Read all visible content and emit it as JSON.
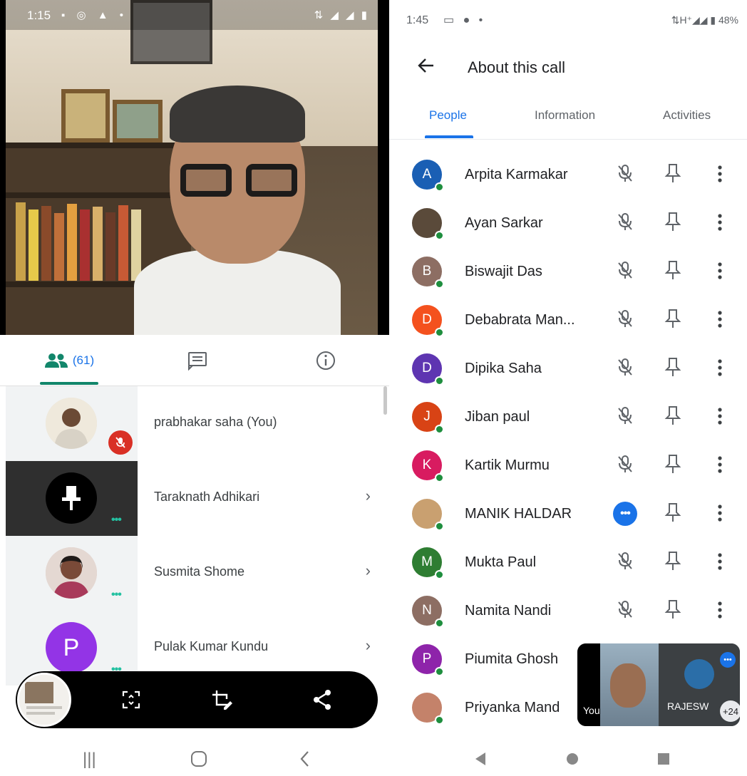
{
  "left": {
    "status": {
      "time": "1:15"
    },
    "tabs": {
      "people_count": "(61)"
    },
    "participants": [
      {
        "name": "prabhakar saha (You)",
        "muted": true
      },
      {
        "name": "Taraknath Adhikari",
        "pinned": true
      },
      {
        "name": "Susmita Shome"
      },
      {
        "name": "Pulak Kumar Kundu",
        "initial": "P",
        "color": "#9334e6"
      }
    ]
  },
  "right": {
    "status": {
      "time": "1:45",
      "battery": "48%"
    },
    "header": {
      "title": "About this call"
    },
    "tabs": {
      "people": "People",
      "information": "Information",
      "activities": "Activities"
    },
    "participants": [
      {
        "name": "Arpita Karmakar",
        "initial": "A",
        "color": "#1a5fb4",
        "muted": true
      },
      {
        "name": "Ayan Sarkar",
        "initial": "",
        "color": "#5a4a3a",
        "muted": true
      },
      {
        "name": "Biswajit Das",
        "initial": "B",
        "color": "#8d6e63",
        "muted": true
      },
      {
        "name": "Debabrata Man...",
        "initial": "D",
        "color": "#f4511e",
        "muted": true
      },
      {
        "name": "Dipika Saha",
        "initial": "D",
        "color": "#5e35b1",
        "muted": true
      },
      {
        "name": "Jiban paul",
        "initial": "J",
        "color": "#d84315",
        "muted": true
      },
      {
        "name": "Kartik Murmu",
        "initial": "K",
        "color": "#d81b60",
        "muted": true
      },
      {
        "name": "MANIK HALDAR",
        "initial": "",
        "color": "#c9a070",
        "muted": false,
        "speaking": true
      },
      {
        "name": "Mukta Paul",
        "initial": "M",
        "color": "#2e7d32",
        "muted": true
      },
      {
        "name": "Namita Nandi",
        "initial": "N",
        "color": "#8d6e63",
        "muted": true
      },
      {
        "name": "Piumita Ghosh",
        "initial": "P",
        "color": "#8e24aa",
        "muted": true
      },
      {
        "name": "Priyanka Mand",
        "initial": "",
        "color": "#c4826a",
        "muted": true
      }
    ],
    "pip": {
      "you_label": "You",
      "other_label": "RAJESW",
      "extra_count": "+24"
    }
  }
}
